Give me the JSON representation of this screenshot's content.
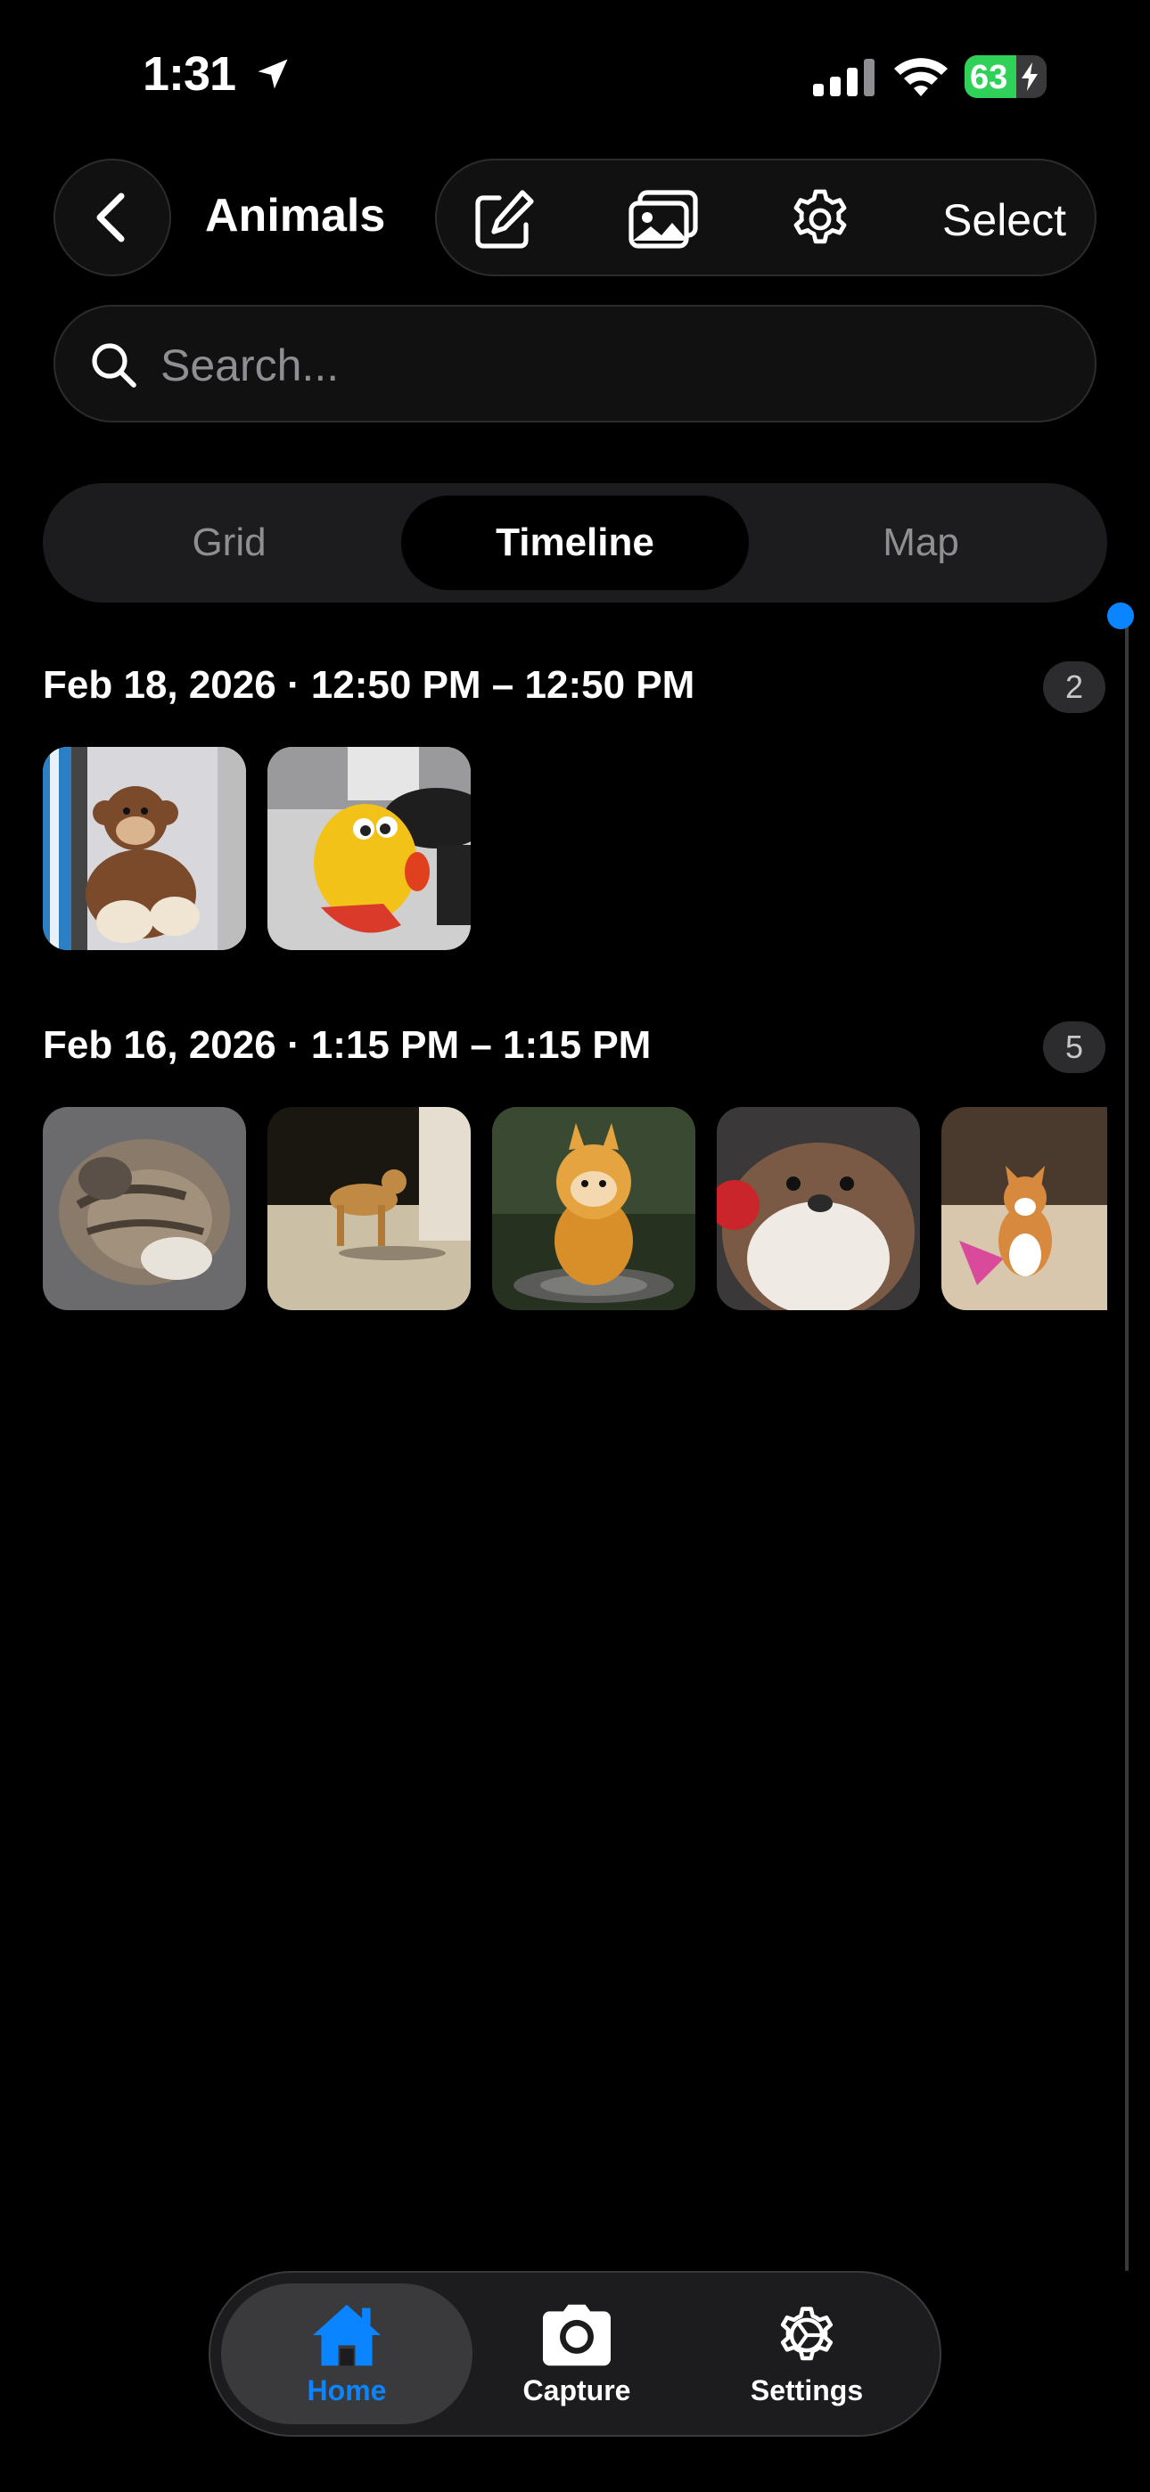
{
  "status_bar": {
    "time": "1:31",
    "battery": "63",
    "battery_level": 0.63
  },
  "header": {
    "title": "Animals",
    "select_label": "Select"
  },
  "search": {
    "placeholder": "Search..."
  },
  "view_tabs": [
    {
      "label": "Grid",
      "active": false
    },
    {
      "label": "Timeline",
      "active": true
    },
    {
      "label": "Map",
      "active": false
    }
  ],
  "sections": [
    {
      "title": "Feb 18, 2026 · 12:50 PM – 12:50 PM",
      "count": "2"
    },
    {
      "title": "Feb 16, 2026 · 1:15 PM – 1:15 PM",
      "count": "5"
    }
  ],
  "tab_bar": [
    {
      "label": "Home",
      "active": true
    },
    {
      "label": "Capture",
      "active": false
    },
    {
      "label": "Settings",
      "active": false
    }
  ],
  "colors": {
    "accent": "#0a84ff",
    "battery": "#30d158",
    "background": "#000000"
  }
}
